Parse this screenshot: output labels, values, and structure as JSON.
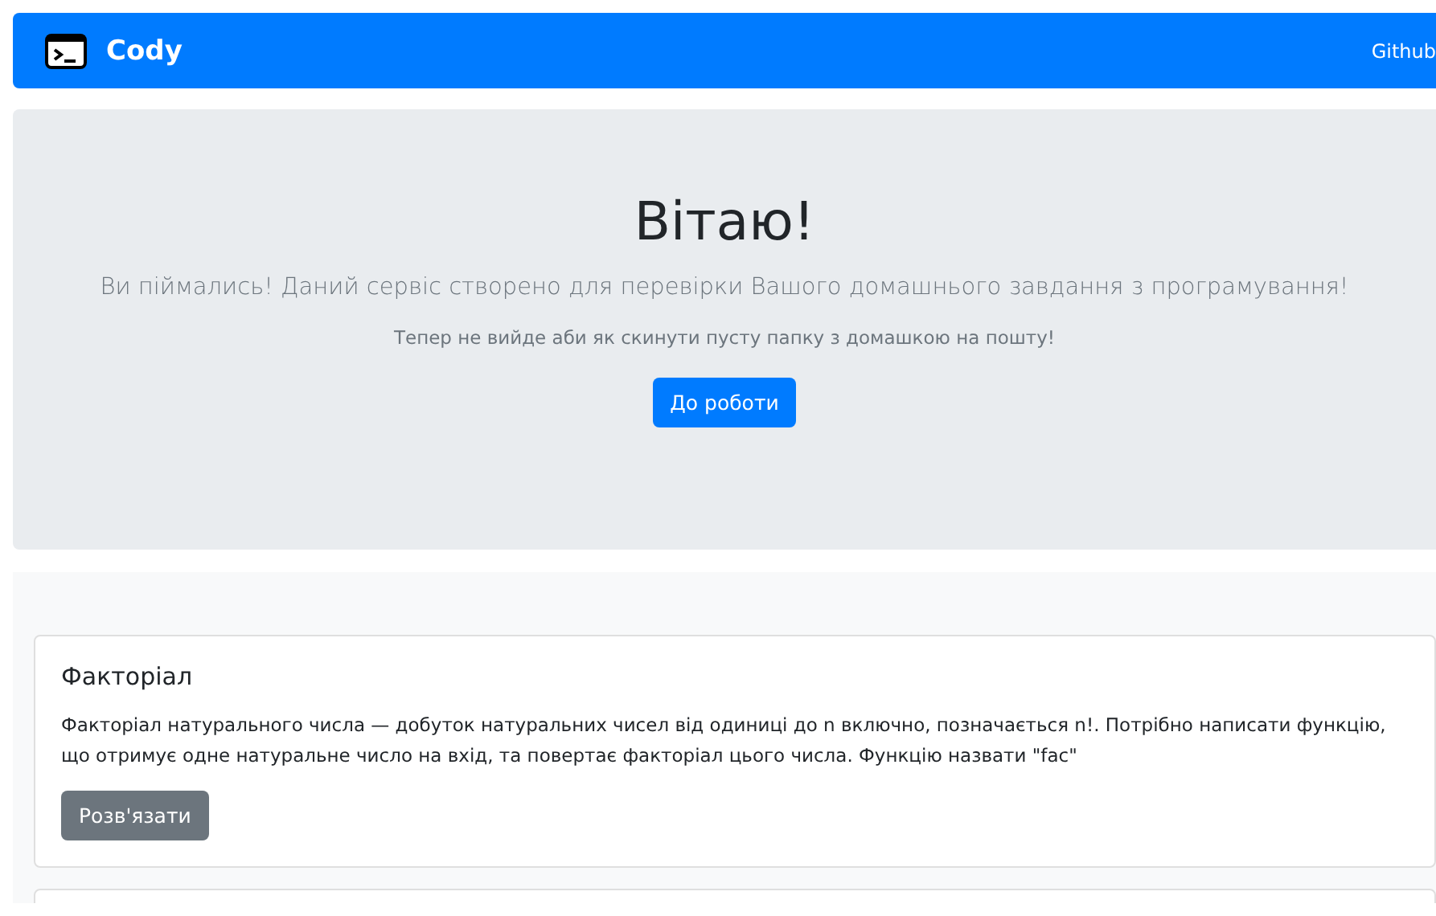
{
  "navbar": {
    "brand": "Cody",
    "links": [
      "Github"
    ]
  },
  "hero": {
    "title": "Вітаю!",
    "lead": "Ви піймались! Даний сервіс створено для перевірки Вашого домашнього завдання з програмування!",
    "text": "Тепер не вийде аби як скинути пусту папку з домашкою на пошту!",
    "button": "До роботи"
  },
  "tasks": [
    {
      "title": "Факторіал",
      "description": "Факторіал натурального числа — добуток натуральних чисел від одиниці до n включно, позначається n!. Потрібно написати функцію, що отримує одне натуральне число на вхід, та повертає факторіал цього числа. Функцію назвати \"fac\"",
      "button": "Розв'язати"
    }
  ]
}
